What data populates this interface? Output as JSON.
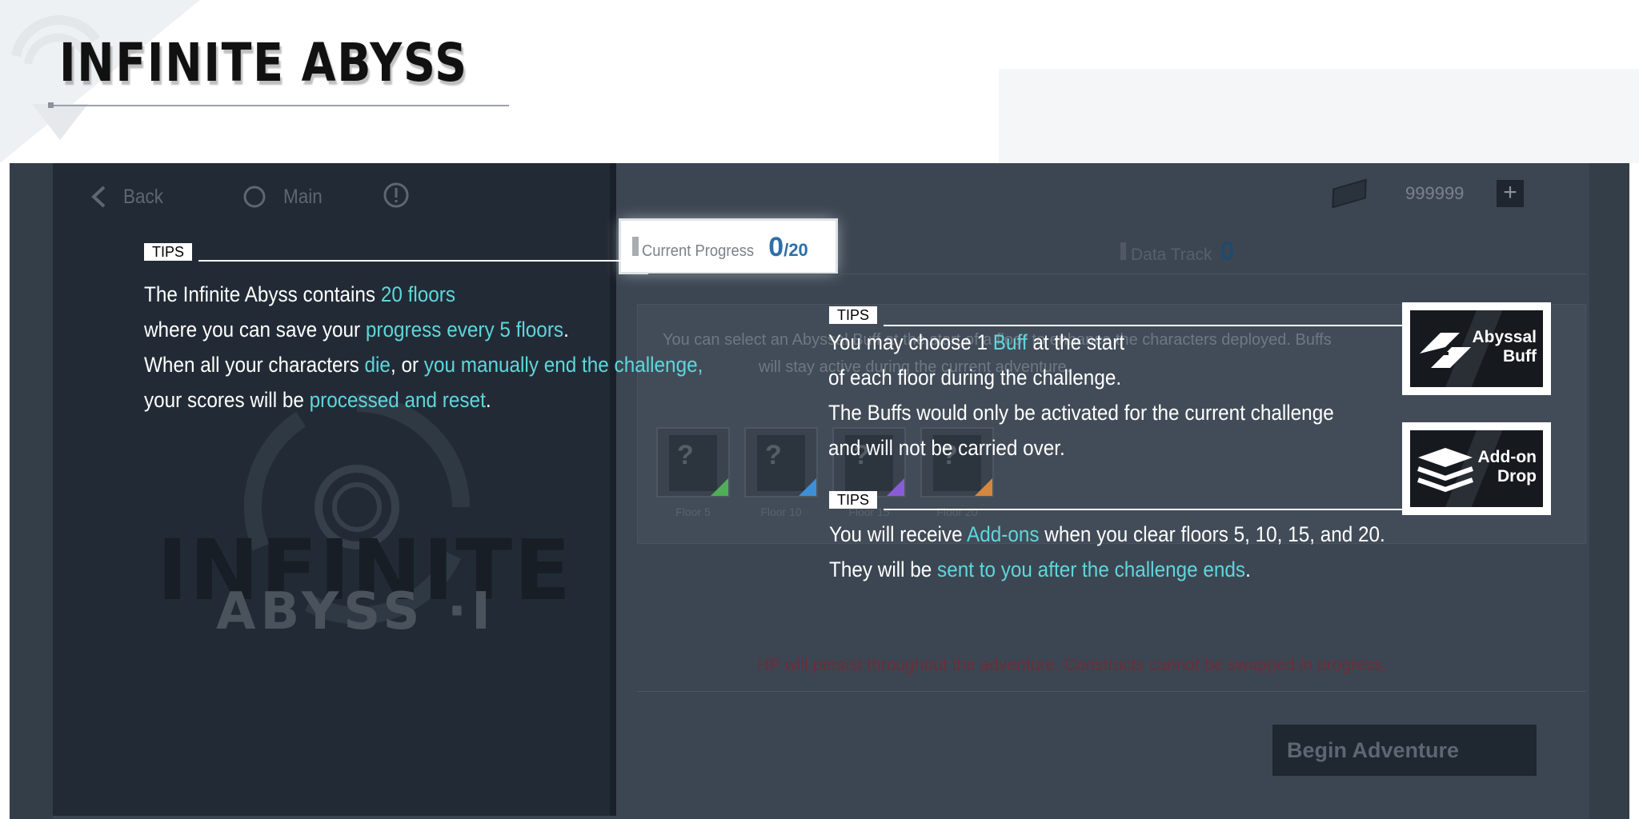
{
  "title": "INFINITE ABYSS",
  "nav": {
    "back_label": "Back",
    "main_label": "Main"
  },
  "banner": {
    "line1": "INFINITE",
    "line2": "ABYSS ·I"
  },
  "currency": {
    "value": "999999",
    "plus": "+"
  },
  "progress": {
    "label": "Current Progress",
    "current": "0",
    "max": "/20"
  },
  "data_track": {
    "label": "Data Track",
    "value": "0"
  },
  "description": {
    "line1": "You can select an Abyssal Buff at the start of a floor to enhance the characters deployed. Buffs",
    "line2": "will stay active during the current adventure."
  },
  "slots": [
    {
      "label": "Floor 5",
      "accent": "#4fae58"
    },
    {
      "label": "Floor 10",
      "accent": "#3f8ed8"
    },
    {
      "label": "Floor 15",
      "accent": "#8a5bd6"
    },
    {
      "label": "Floor 20",
      "accent": "#d6873f"
    }
  ],
  "warning": "HP will persist throughout the adventure. Constructs cannot be swapped in progress.",
  "begin_label": "Begin Adventure",
  "tips": {
    "tag": "TIPS",
    "left": {
      "l1a": "The Infinite Abyss contains ",
      "l1b": "20 floors",
      "l2a": "where you can save your ",
      "l2b": "progress every 5 floors",
      "l2c": ".",
      "l3a": "When all your characters ",
      "l3b": "die",
      "l3c": ", or ",
      "l3d": "you manually end the challenge,",
      "l4a": "your scores will be ",
      "l4b": "processed and reset",
      "l4c": "."
    },
    "buff": {
      "l1a": "You may choose 1 ",
      "l1b": "Buff",
      "l1c": " at the start",
      "l2": "of each floor during the challenge.",
      "l3": "The Buffs would only be activated for the current challenge",
      "l4": "and will not be carried over."
    },
    "addon": {
      "l1a": "You will receive ",
      "l1b": "Add-ons",
      "l1c": " when you clear floors 5, 10, 15, and 20.",
      "l2a": "They will be ",
      "l2b": "sent to you after the challenge ends",
      "l2c": "."
    }
  },
  "badges": {
    "buff": {
      "line1": "Abyssal",
      "line2": "Buff"
    },
    "drop": {
      "line1": "Add-on",
      "line2": "Drop"
    }
  }
}
